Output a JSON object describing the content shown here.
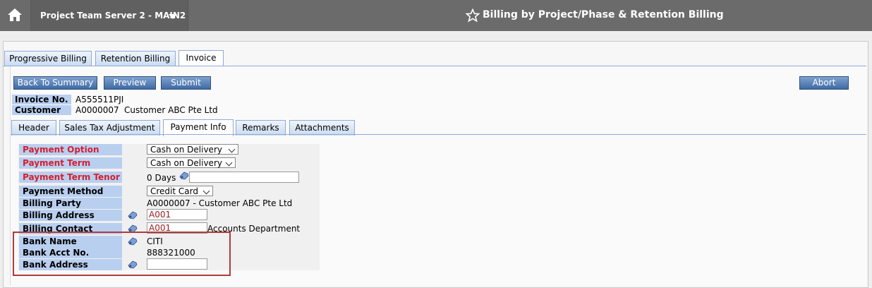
{
  "topbar": {
    "server_label": "Project Team Server 2 - MAIN2",
    "page_title": "Billing by Project/Phase & Retention Billing"
  },
  "tabs": [
    {
      "label": "Progressive Billing"
    },
    {
      "label": "Retention Billing"
    },
    {
      "label": "Invoice"
    }
  ],
  "toolbar": {
    "back_label": "Back To Summary",
    "preview_label": "Preview",
    "submit_label": "Submit",
    "abort_label": "Abort"
  },
  "invoice": {
    "invoice_no_label": "Invoice No.",
    "invoice_no_value": "A555511PJI",
    "customer_label": "Customer",
    "customer_code": "A0000007",
    "customer_name": "Customer ABC Pte Ltd"
  },
  "subtabs": [
    {
      "label": "Header"
    },
    {
      "label": "Sales Tax Adjustment"
    },
    {
      "label": "Payment Info"
    },
    {
      "label": "Remarks"
    },
    {
      "label": "Attachments"
    }
  ],
  "form": {
    "payment_option_label": "Payment Option",
    "payment_option_value": "Cash on Delivery",
    "payment_term_label": "Payment Term",
    "payment_term_value": "Cash on Delivery",
    "payment_term_tenor_label": "Payment Term Tenor",
    "payment_term_tenor_value": "0 Days",
    "payment_method_label": "Payment Method",
    "payment_method_value": "Credit Card",
    "billing_party_label": "Billing Party",
    "billing_party_value": "A0000007 - Customer ABC Pte Ltd",
    "billing_address_label": "Billing Address",
    "billing_address_value": "A001",
    "billing_contact_label": "Billing Contact",
    "billing_contact_value": "A001",
    "billing_contact_name": "Accounts Department",
    "bank_name_label": "Bank Name",
    "bank_name_value": "CITI",
    "bank_acct_label": "Bank Acct No.",
    "bank_acct_value": "888321000",
    "bank_address_label": "Bank Address"
  },
  "colors": {
    "topbar": "#6b6b6b",
    "label_bg": "#b9cff0",
    "required_text": "#d3202f",
    "button": "#3f6aa5",
    "highlight_box": "#b23a3a"
  },
  "icons": [
    "home-icon",
    "chevron-down-icon",
    "star-icon",
    "lookup-icon"
  ]
}
